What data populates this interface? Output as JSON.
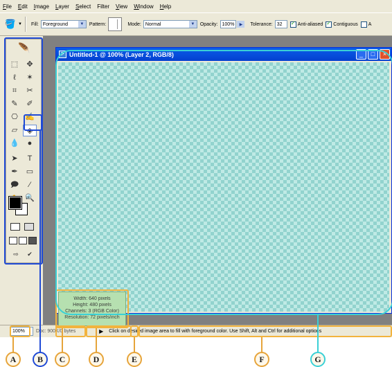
{
  "menu": [
    {
      "key": "F",
      "rest": "ile"
    },
    {
      "key": "E",
      "rest": "dit"
    },
    {
      "key": "I",
      "rest": "mage"
    },
    {
      "key": "L",
      "rest": "ayer"
    },
    {
      "key": "S",
      "rest": "elect"
    },
    {
      "key": "Filter",
      "rest": ""
    },
    {
      "key": "V",
      "rest": "iew"
    },
    {
      "key": "W",
      "rest": "indow"
    },
    {
      "key": "H",
      "rest": "elp"
    }
  ],
  "options": {
    "fill_label": "Fill:",
    "fill_value": "Foreground",
    "pattern_label": "Pattern:",
    "mode_label": "Mode:",
    "mode_value": "Normal",
    "opacity_label": "Opacity:",
    "opacity_value": "100%",
    "tolerance_label": "Tolerance:",
    "tolerance_value": "32",
    "antialiased_label": "Anti-aliased",
    "contiguous_label": "Contiguous",
    "extra_label": "A"
  },
  "document": {
    "title": "Untitled-1 @ 100% (Layer 2, RGB/8)"
  },
  "status": {
    "zoom": "100%",
    "doc_size": "Doc: 900K/0 bytes",
    "hint": "Click on desired image area to fill with foreground color.  Use Shift, Alt and Ctrl for additional options"
  },
  "doc_info": {
    "width": "Width: 640 pixels",
    "height": "Height: 480 pixels",
    "channels": "Channels: 3 (RGB Color)",
    "resolution": "Resolution: 72 pixels/inch"
  },
  "callouts": [
    "A",
    "B",
    "C",
    "D",
    "E",
    "F",
    "G"
  ],
  "colors": {
    "highlight_orange": "#f2b33d",
    "highlight_blue": "#1f4ad6",
    "highlight_cyan": "#3ad0d6",
    "title_blue": "#0a5de8"
  }
}
